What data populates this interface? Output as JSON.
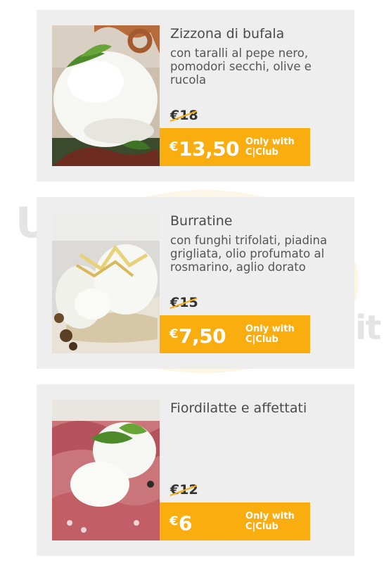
{
  "background": {
    "watermark_left": "U",
    "watermark_right": "it"
  },
  "colors": {
    "card_bg": "#eeeeee",
    "promo_bg": "#f9ad0e",
    "text": "#4a4a4a"
  },
  "items": [
    {
      "title": "Zizzona di bufala",
      "description": "con taralli al pepe nero, pomodori secchi, olive e rucola",
      "old_price": "€18",
      "currency": "€",
      "club_price": "13,50",
      "club_label": "Only with C|Club",
      "image": "mozzarella-with-taralli-photo"
    },
    {
      "title": "Burratine",
      "description": "con funghi trifolati, piadina grigliata, olio profumato al rosmarino, aglio dorato",
      "old_price": "€15",
      "currency": "€",
      "club_price": "7,50",
      "club_label": "Only with C|Club",
      "image": "burrata-with-piadina-photo"
    },
    {
      "title": "Fiordilatte e affettati",
      "description": "",
      "old_price": "€12",
      "currency": "€",
      "club_price": "6",
      "club_label": "Only with C|Club",
      "image": "fiordilatte-with-cured-meats-photo"
    }
  ]
}
